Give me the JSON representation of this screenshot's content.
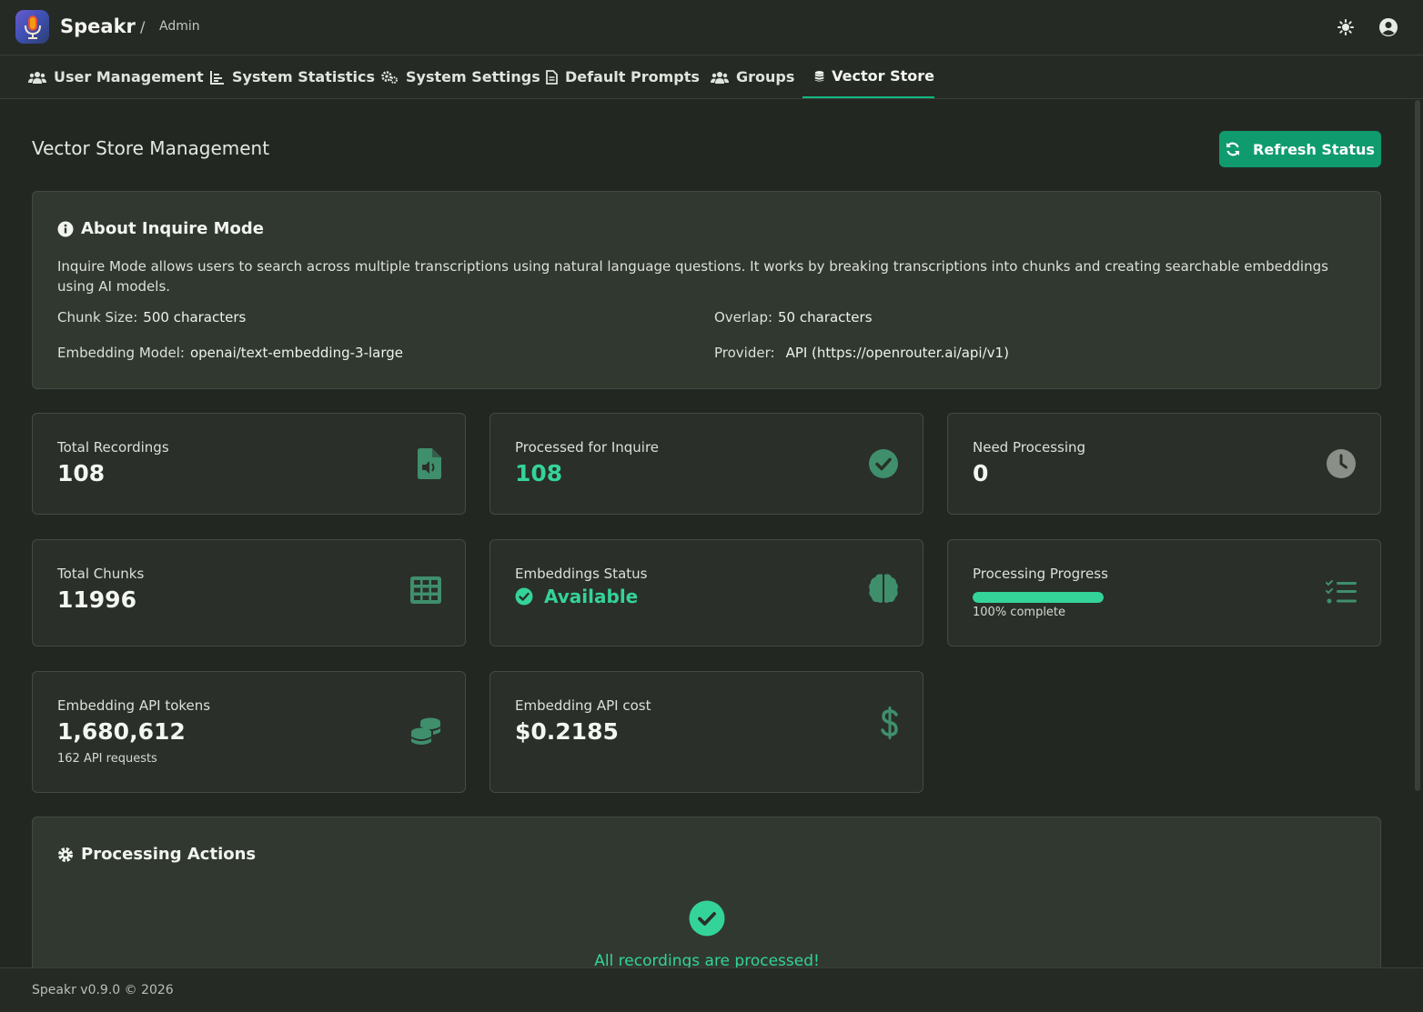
{
  "header": {
    "brand": "Speakr",
    "separator": "/",
    "crumb": "Admin"
  },
  "tabs": [
    {
      "label": "User Management",
      "icon": "users-icon"
    },
    {
      "label": "System Statistics",
      "icon": "chart-icon"
    },
    {
      "label": "System Settings",
      "icon": "cogs-icon"
    },
    {
      "label": "Default Prompts",
      "icon": "file-icon"
    },
    {
      "label": "Groups",
      "icon": "users-icon"
    },
    {
      "label": "Vector Store",
      "icon": "database-icon",
      "active": true
    }
  ],
  "page": {
    "title": "Vector Store Management",
    "refresh_label": "Refresh Status"
  },
  "about": {
    "title": "About Inquire Mode",
    "text": "Inquire Mode allows users to search across multiple transcriptions using natural language questions. It works by breaking transcriptions into chunks and creating searchable embeddings using AI models.",
    "chunk_size_label": "Chunk Size:",
    "chunk_size_value": "500 characters",
    "overlap_label": "Overlap:",
    "overlap_value": "50 characters",
    "model_label": "Embedding Model:",
    "model_value": "openai/text-embedding-3-large",
    "provider_label": "Provider:",
    "provider_value": "API (https://openrouter.ai/api/v1)"
  },
  "cards": {
    "total_recordings": {
      "label": "Total Recordings",
      "value": "108"
    },
    "processed": {
      "label": "Processed for Inquire",
      "value": "108"
    },
    "need_processing": {
      "label": "Need Processing",
      "value": "0"
    },
    "total_chunks": {
      "label": "Total Chunks",
      "value": "11996"
    },
    "embeddings_status": {
      "label": "Embeddings Status",
      "value": "Available"
    },
    "processing_progress": {
      "label": "Processing Progress",
      "percent": 100,
      "caption": "100% complete"
    },
    "api_tokens": {
      "label": "Embedding API tokens",
      "value": "1,680,612",
      "sub": "162 API requests"
    },
    "api_cost": {
      "label": "Embedding API cost",
      "value": "$0.2185"
    }
  },
  "actions": {
    "title": "Processing Actions",
    "message": "All recordings are processed!"
  },
  "footer": {
    "text": "Speakr v0.9.0 © 2026"
  },
  "colors": {
    "accent": "#10b981",
    "success": "#34d399",
    "background": "#232722"
  }
}
